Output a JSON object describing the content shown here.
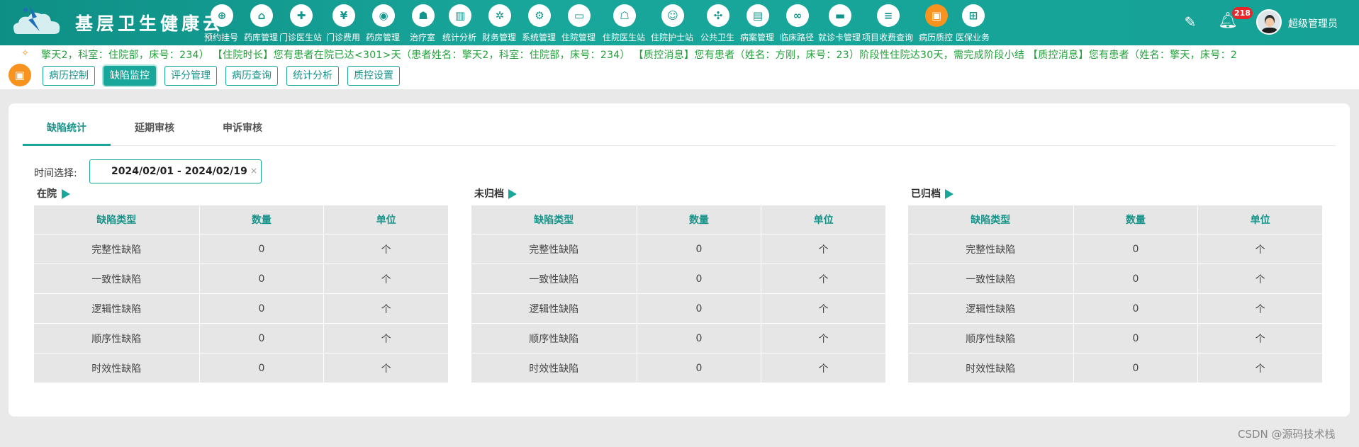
{
  "app": {
    "title": "基层卫生健康云"
  },
  "nav": [
    {
      "label": "预约挂号",
      "icon": "calendar-plus-icon",
      "glyph": "⊕"
    },
    {
      "label": "药库管理",
      "icon": "warehouse-icon",
      "glyph": "⌂"
    },
    {
      "label": "门诊医生站",
      "icon": "doctor-icon",
      "glyph": "✚"
    },
    {
      "label": "门诊费用",
      "icon": "yen-icon",
      "glyph": "¥"
    },
    {
      "label": "药房管理",
      "icon": "pill-icon",
      "glyph": "◉"
    },
    {
      "label": "治疗室",
      "icon": "treatment-icon",
      "glyph": "☗"
    },
    {
      "label": "统计分析",
      "icon": "bar-chart-icon",
      "glyph": "▥"
    },
    {
      "label": "财务管理",
      "icon": "gear-money-icon",
      "glyph": "✲"
    },
    {
      "label": "系统管理",
      "icon": "gear-icon",
      "glyph": "⚙"
    },
    {
      "label": "住院管理",
      "icon": "bed-icon",
      "glyph": "▭"
    },
    {
      "label": "住院医生站",
      "icon": "doctor-card-icon",
      "glyph": "☖"
    },
    {
      "label": "住院护士站",
      "icon": "nurse-icon",
      "glyph": "☺"
    },
    {
      "label": "公共卫生",
      "icon": "public-health-icon",
      "glyph": "✣"
    },
    {
      "label": "病案管理",
      "icon": "record-icon",
      "glyph": "▤"
    },
    {
      "label": "临床路径",
      "icon": "path-icon",
      "glyph": "∞"
    },
    {
      "label": "就诊卡管理",
      "icon": "card-icon",
      "glyph": "▬"
    },
    {
      "label": "项目收费查询",
      "icon": "fee-search-icon",
      "glyph": "≡"
    },
    {
      "label": "病历质控",
      "icon": "quality-control-icon",
      "glyph": "▣",
      "active": true
    },
    {
      "label": "医保业务",
      "icon": "insurance-icon",
      "glyph": "⊞"
    }
  ],
  "header": {
    "notification_count": "218",
    "username": "超级管理员"
  },
  "ticker": {
    "text": "擎天2，科室：住院部，床号：234）       【住院时长】您有患者在院已达<301>天（患者姓名：擎天2，科室：住院部，床号：234）       【质控消息】您有患者（姓名：方刚，床号：23）阶段性住院达30天，需完成阶段小结       【质控消息】您有患者（姓名：擎天，床号：2"
  },
  "subnav": {
    "tabs": [
      "病历控制",
      "缺陷监控",
      "评分管理",
      "病历查询",
      "统计分析",
      "质控设置"
    ],
    "active": "缺陷监控"
  },
  "panel": {
    "tabs": [
      "缺陷统计",
      "延期审核",
      "申诉审核"
    ],
    "active_tab": "缺陷统计",
    "date_label": "时间选择:",
    "date_range": "2024/02/01 - 2024/02/19",
    "headers": [
      "缺陷类型",
      "数量",
      "单位"
    ],
    "sections": [
      {
        "title": "在院",
        "rows": [
          [
            "完整性缺陷",
            "0",
            "个"
          ],
          [
            "一致性缺陷",
            "0",
            "个"
          ],
          [
            "逻辑性缺陷",
            "0",
            "个"
          ],
          [
            "顺序性缺陷",
            "0",
            "个"
          ],
          [
            "时效性缺陷",
            "0",
            "个"
          ]
        ]
      },
      {
        "title": "未归档",
        "rows": [
          [
            "完整性缺陷",
            "0",
            "个"
          ],
          [
            "一致性缺陷",
            "0",
            "个"
          ],
          [
            "逻辑性缺陷",
            "0",
            "个"
          ],
          [
            "顺序性缺陷",
            "0",
            "个"
          ],
          [
            "时效性缺陷",
            "0",
            "个"
          ]
        ]
      },
      {
        "title": "已归档",
        "rows": [
          [
            "完整性缺陷",
            "0",
            "个"
          ],
          [
            "一致性缺陷",
            "0",
            "个"
          ],
          [
            "逻辑性缺陷",
            "0",
            "个"
          ],
          [
            "顺序性缺陷",
            "0",
            "个"
          ],
          [
            "时效性缺陷",
            "0",
            "个"
          ]
        ]
      }
    ]
  },
  "watermark": "CSDN @源码技术栈",
  "colors": {
    "primary": "#19a79b",
    "accent": "#f7931e",
    "ticker_text": "#22a23a",
    "badge": "#e7262b"
  }
}
